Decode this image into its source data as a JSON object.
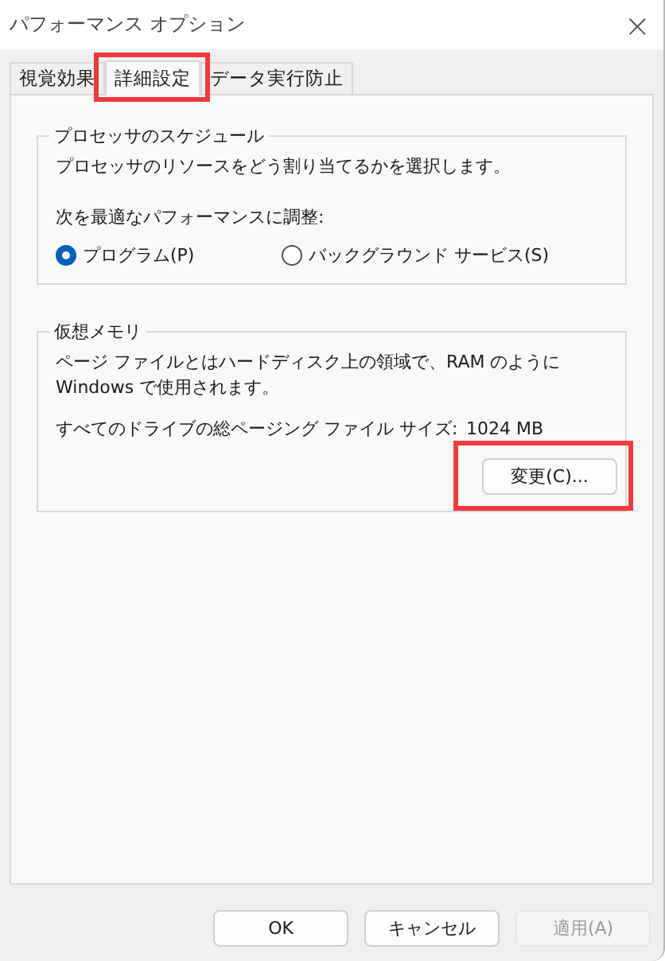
{
  "window": {
    "title": "パフォーマンス オプション",
    "close": "×"
  },
  "tabs": [
    {
      "label": "視覚効果",
      "selected": false,
      "highlighted": false
    },
    {
      "label": "詳細設定",
      "selected": true,
      "highlighted": true
    },
    {
      "label": "データ実行防止",
      "selected": false,
      "highlighted": false
    }
  ],
  "processor_group": {
    "title": "プロセッサのスケジュール",
    "description": "プロセッサのリソースをどう割り当てるかを選択します。",
    "adjust_label": "次を最適なパフォーマンスに調整:",
    "options": [
      {
        "label": "プログラム(P)",
        "selected": true
      },
      {
        "label": "バックグラウンド サービス(S)",
        "selected": false
      }
    ]
  },
  "memory_group": {
    "title": "仮想メモリ",
    "description": "ページ ファイルとはハードディスク上の領域で、RAM のように Windows で使用されます。",
    "size_label": "すべてのドライブの総ページング ファイル サイズ:",
    "size_value": "1024 MB",
    "change_button": {
      "label": "変更(C)...",
      "highlighted": true
    }
  },
  "buttons": [
    {
      "label": "OK",
      "disabled": false
    },
    {
      "label": "キャンセル",
      "disabled": false
    },
    {
      "label": "適用(A)",
      "disabled": true
    }
  ]
}
